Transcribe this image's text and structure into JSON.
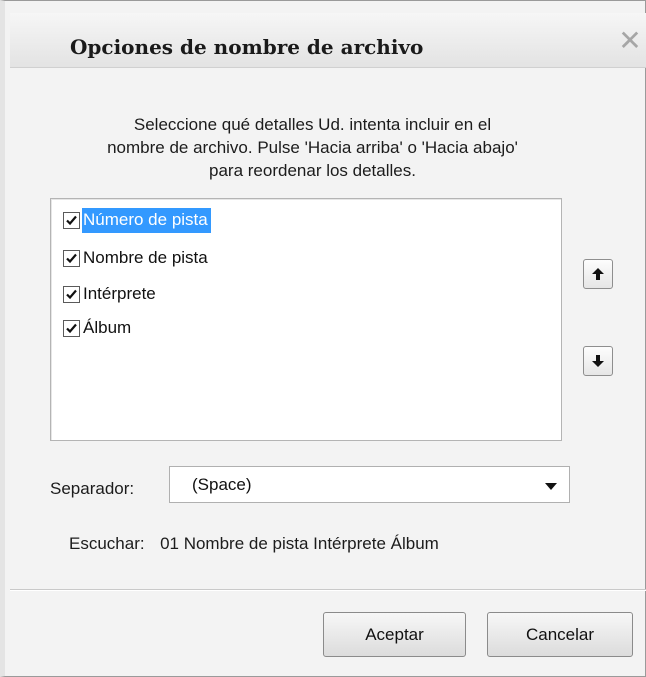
{
  "dialog": {
    "title": "Opciones de nombre de archivo",
    "close_glyph": "✕"
  },
  "instructions": {
    "line1": "Seleccione qué detalles Ud. intenta incluir en el",
    "line2": "nombre de archivo. Pulse 'Hacia arriba' o 'Hacia abajo'",
    "line3": "para reordenar los detalles."
  },
  "details": {
    "items": [
      {
        "label": "Número de pista",
        "checked": true,
        "selected": true
      },
      {
        "label": "Nombre de pista",
        "checked": true,
        "selected": false
      },
      {
        "label": "Intérprete",
        "checked": true,
        "selected": false
      },
      {
        "label": "Álbum",
        "checked": true,
        "selected": false
      }
    ],
    "move_up_icon": "arrow-up-icon",
    "move_down_icon": "arrow-down-icon"
  },
  "separator": {
    "label": "Separador:",
    "value": "(Space)"
  },
  "preview": {
    "label": "Escuchar:",
    "value": "01 Nombre de pista Intérprete Álbum"
  },
  "buttons": {
    "ok": "Aceptar",
    "cancel": "Cancelar"
  },
  "colors": {
    "selection": "#3399ff",
    "dialog_background": "#f3f3f3"
  }
}
